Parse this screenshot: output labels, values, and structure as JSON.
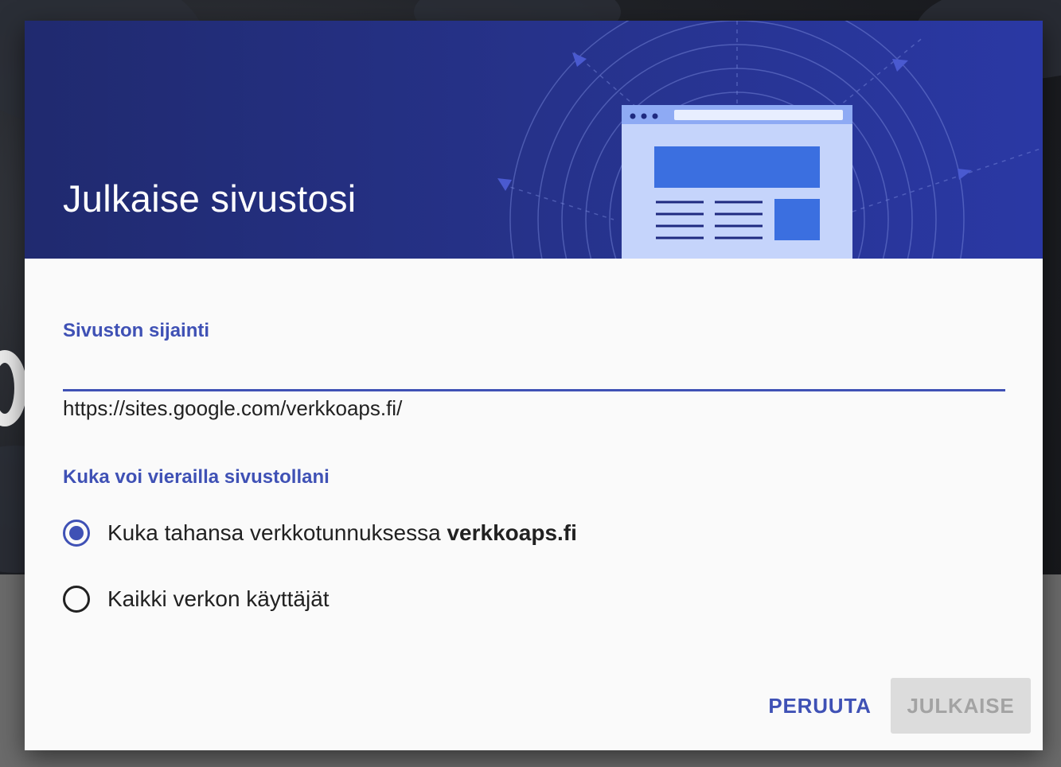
{
  "dialog": {
    "title": "Julkaise sivustosi"
  },
  "location": {
    "label": "Sivuston sijainti",
    "url": "https://sites.google.com/verkkoaps.fi/"
  },
  "visibility": {
    "label": "Kuka voi vierailla sivustollani",
    "options": [
      {
        "label": "Kuka tahansa verkkotunnuksessa",
        "domain": "verkkoaps.fi",
        "selected": true
      },
      {
        "label": "Kaikki verkon käyttäjät",
        "selected": false
      }
    ]
  },
  "actions": {
    "cancel_label": "PERUUTA",
    "publish_label": "JULKAISE",
    "publish_enabled": false
  },
  "colors": {
    "accent": "#3f51b5",
    "header_bg": "#26328a",
    "disabled_bg": "#dcdcdc",
    "disabled_text": "#a3a3a3"
  }
}
